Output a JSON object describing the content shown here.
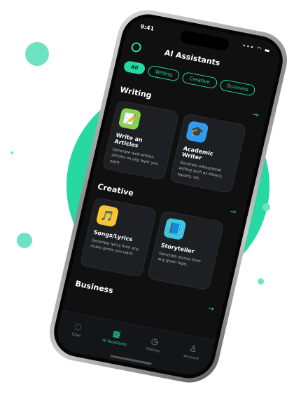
{
  "status": {
    "time": "9:41",
    "icons": "••• ◠ ▬"
  },
  "header": {
    "title": "AI Assistants",
    "logo_icon": "openai-logo-icon"
  },
  "filters": [
    {
      "label": "All",
      "active": true
    },
    {
      "label": "Writing",
      "active": false
    },
    {
      "label": "Creative",
      "active": false
    },
    {
      "label": "Business",
      "active": false
    }
  ],
  "sections": [
    {
      "title": "Writing",
      "arrow": "→",
      "cards": [
        {
          "icon": "notepad-icon",
          "icon_glyph": "📝",
          "icon_bg": "#8bd14a",
          "title": "Write an Articles",
          "desc": "Generate well-written articles on any topic you want"
        },
        {
          "icon": "graduation-cap-icon",
          "icon_glyph": "🎓",
          "icon_bg": "#2f9cf4",
          "title": "Academic Writer",
          "desc": "Generate educational writing such as essays, reports, etc."
        }
      ]
    },
    {
      "title": "Creative",
      "arrow": "→",
      "cards": [
        {
          "icon": "music-note-icon",
          "icon_glyph": "🎵",
          "icon_bg": "#f7c531",
          "title": "Songs/Lyrics",
          "desc": "Generate lyrics from any music genre you want."
        },
        {
          "icon": "book-icon",
          "icon_glyph": "📘",
          "icon_bg": "#3ec7e0",
          "title": "Storyteller",
          "desc": "Generate stories from any given topic."
        }
      ]
    },
    {
      "title": "Business",
      "arrow": "→"
    }
  ],
  "tabs": [
    {
      "label": "Chat",
      "icon": "chat-bubble-icon",
      "glyph": "◌",
      "active": false
    },
    {
      "label": "AI Assistants",
      "icon": "grid-icon",
      "glyph": "▦",
      "active": true
    },
    {
      "label": "History",
      "icon": "clock-icon",
      "glyph": "◷",
      "active": false
    },
    {
      "label": "Account",
      "icon": "user-icon",
      "glyph": "♙",
      "active": false
    }
  ],
  "colors": {
    "accent": "#26d9a2",
    "background": "#101010",
    "card": "#1d1f22"
  }
}
